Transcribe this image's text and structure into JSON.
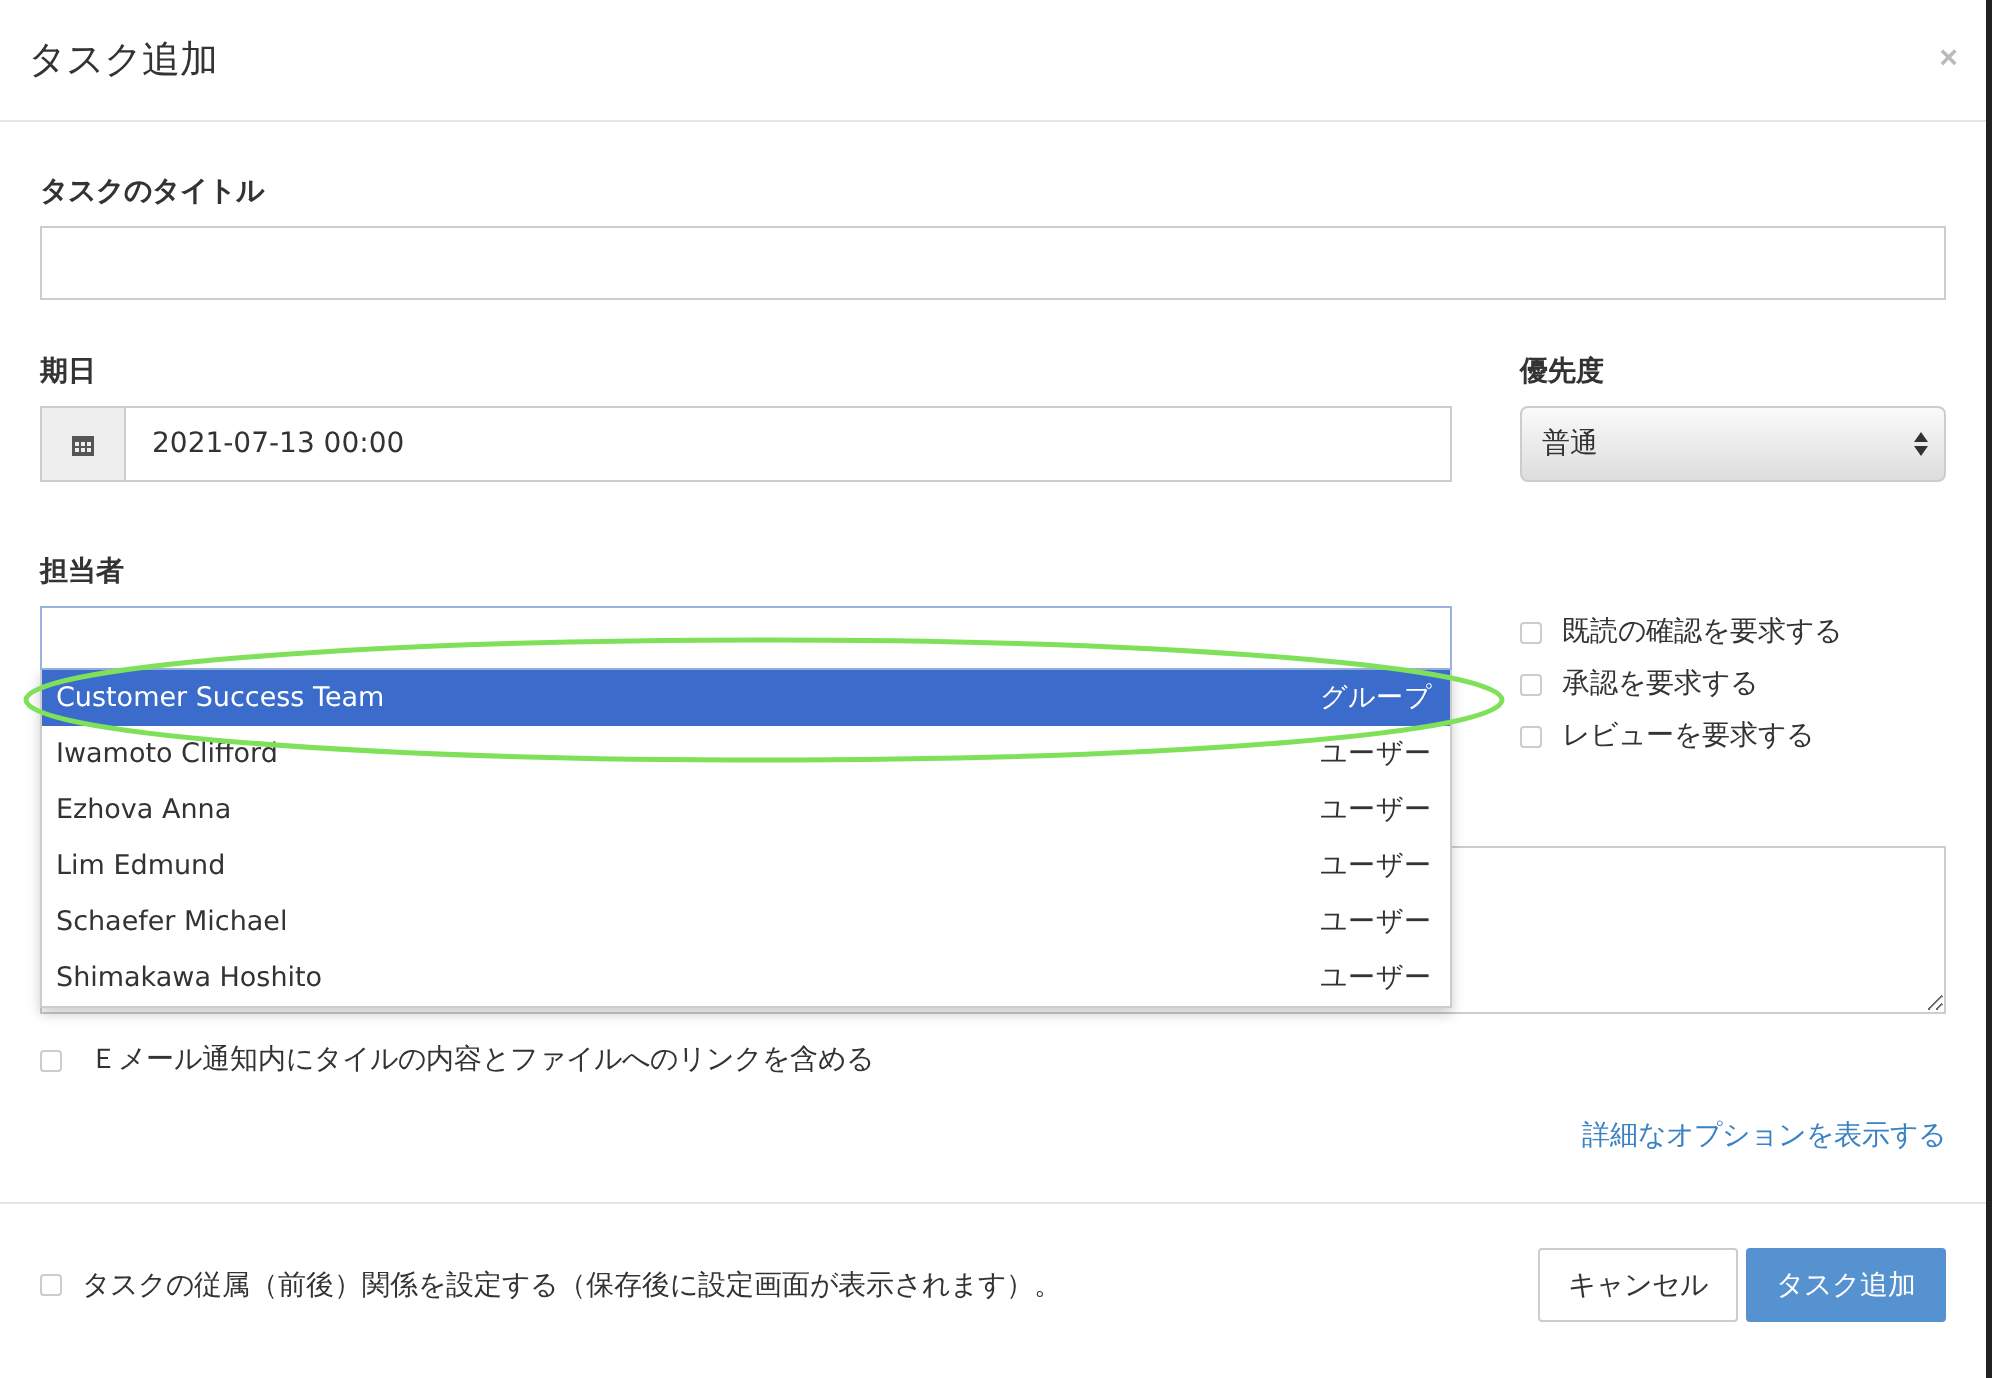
{
  "dialog": {
    "title": "タスク追加",
    "close": "×"
  },
  "title_field": {
    "label": "タスクのタイトル"
  },
  "due_date": {
    "label": "期日",
    "value": "2021-07-13 00:00"
  },
  "priority": {
    "label": "優先度",
    "value": "普通"
  },
  "assignee": {
    "label": "担当者",
    "suggestions": [
      {
        "name": "Customer Success Team",
        "type": "グループ",
        "selected": true
      },
      {
        "name": "Iwamoto Clifford",
        "type": "ユーザー",
        "selected": false
      },
      {
        "name": "Ezhova Anna",
        "type": "ユーザー",
        "selected": false
      },
      {
        "name": "Lim Edmund",
        "type": "ユーザー",
        "selected": false
      },
      {
        "name": "Schaefer Michael",
        "type": "ユーザー",
        "selected": false
      },
      {
        "name": "Shimakawa Hoshito",
        "type": "ユーザー",
        "selected": false
      }
    ],
    "highlighted": true
  },
  "options": [
    {
      "label": "既読の確認を要求する",
      "checked": false
    },
    {
      "label": "承認を要求する",
      "checked": false
    },
    {
      "label": "レビューを要求する",
      "checked": false
    }
  ],
  "email_option": {
    "label": "Ｅメール通知内にタイルの内容とファイルへのリンクを含める",
    "checked": false
  },
  "advanced_link": "詳細なオプションを表示する",
  "footer": {
    "dependency_option": {
      "label": "タスクの従属（前後）関係を設定する（保存後に設定画面が表示されます）。",
      "checked": false
    },
    "buttons": [
      {
        "label": "キャンセル",
        "kind": "secondary"
      },
      {
        "label": "タスク追加",
        "kind": "primary"
      }
    ]
  }
}
